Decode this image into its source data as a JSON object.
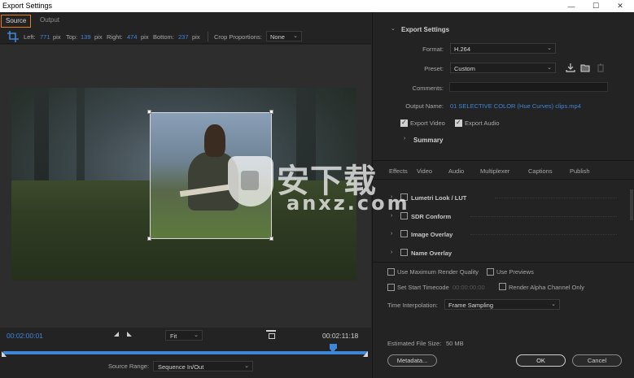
{
  "window": {
    "title": "Export Settings",
    "minimize": "—",
    "maximize": "☐",
    "close": "✕"
  },
  "tabs": {
    "source": "Source",
    "output": "Output"
  },
  "crop": {
    "left_label": "Left:",
    "left_value": "771",
    "left_unit": "pix",
    "top_label": "Top:",
    "top_value": "139",
    "top_unit": "pix",
    "right_label": "Right:",
    "right_value": "474",
    "right_unit": "pix",
    "bottom_label": "Bottom:",
    "bottom_value": "237",
    "bottom_unit": "pix",
    "proportions_label": "Crop Proportions:",
    "proportions_value": "None"
  },
  "timecode": {
    "current": "00:02:00:01",
    "end": "00:02:11:18",
    "fit": "Fit",
    "playhead_fraction": 0.905
  },
  "source_range": {
    "label": "Source Range:",
    "value": "Sequence In/Out"
  },
  "export_settings": {
    "header": "Export Settings",
    "format_label": "Format:",
    "format_value": "H.264",
    "preset_label": "Preset:",
    "preset_value": "Custom",
    "comments_label": "Comments:",
    "output_name_label": "Output Name:",
    "output_name_value": "01 SELECTIVE COLOR (Hue Curves) clips.mp4",
    "export_video": "Export Video",
    "export_audio": "Export Audio",
    "summary": "Summary"
  },
  "right_tabs": [
    "Effects",
    "Video",
    "Audio",
    "Multiplexer",
    "Captions",
    "Publish"
  ],
  "effects": {
    "lumetri": "Lumetri Look / LUT",
    "sdr": "SDR Conform",
    "image_overlay": "Image Overlay",
    "name_overlay": "Name Overlay"
  },
  "options": {
    "max_render_quality": "Use Maximum Render Quality",
    "use_previews": "Use Previews",
    "set_start_timecode": "Set Start Timecode",
    "start_timecode_value": "00:00:00:00",
    "render_alpha": "Render Alpha Channel Only",
    "time_interp_label": "Time Interpolation:",
    "time_interp_value": "Frame Sampling",
    "est_file_size_label": "Estimated File Size:",
    "est_file_size_value": "50 MB"
  },
  "buttons": {
    "metadata": "Metadata...",
    "ok": "OK",
    "cancel": "Cancel"
  },
  "watermark": {
    "text": "安下载",
    "url": "anxz.com"
  },
  "colors": {
    "accent_blue": "#3f86d8",
    "tab_orange": "#e07f1c",
    "panel_bg": "#232323"
  }
}
